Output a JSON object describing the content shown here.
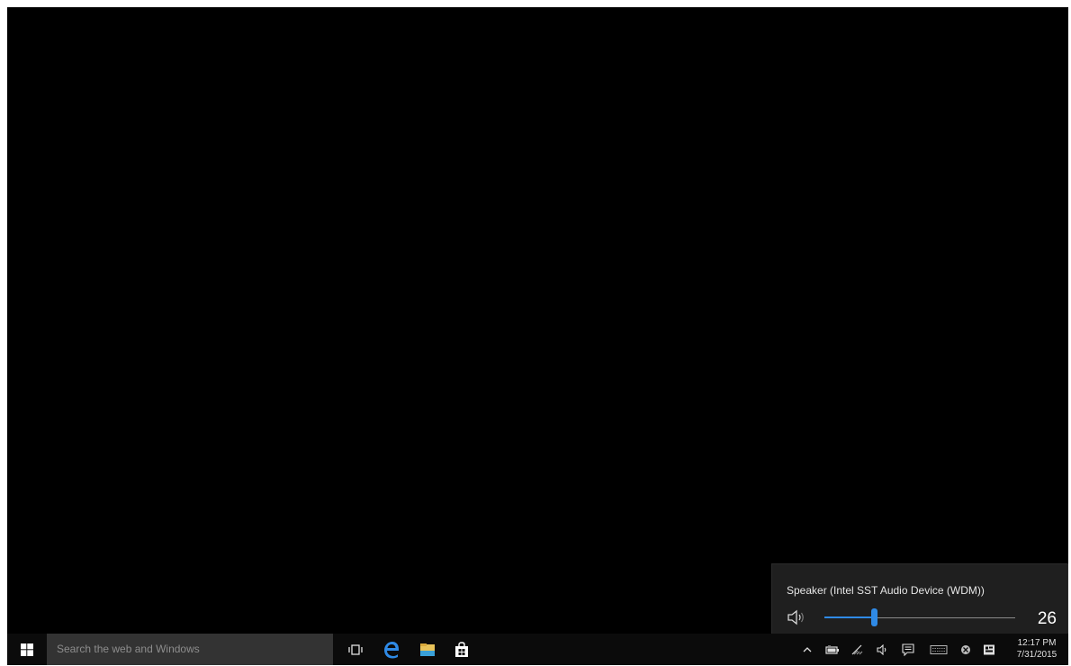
{
  "volume_flyout": {
    "device_name": "Speaker (Intel SST Audio Device (WDM))",
    "volume": 26,
    "volume_text": "26",
    "accent_color": "#2f8ae6"
  },
  "taskbar": {
    "search_placeholder": "Search the web and Windows",
    "pinned": [
      {
        "name": "task-view",
        "icon": "task-view-icon"
      },
      {
        "name": "edge",
        "icon": "edge-icon"
      },
      {
        "name": "file-explorer",
        "icon": "folder-icon"
      },
      {
        "name": "store",
        "icon": "store-icon"
      }
    ],
    "tray_icons": [
      "chevron-up-icon",
      "battery-icon",
      "network-icon",
      "speaker-icon",
      "action-center-icon",
      "keyboard-icon",
      "app-icon",
      "notification-icon"
    ],
    "clock": {
      "time": "12:17 PM",
      "date": "7/31/2015"
    }
  }
}
